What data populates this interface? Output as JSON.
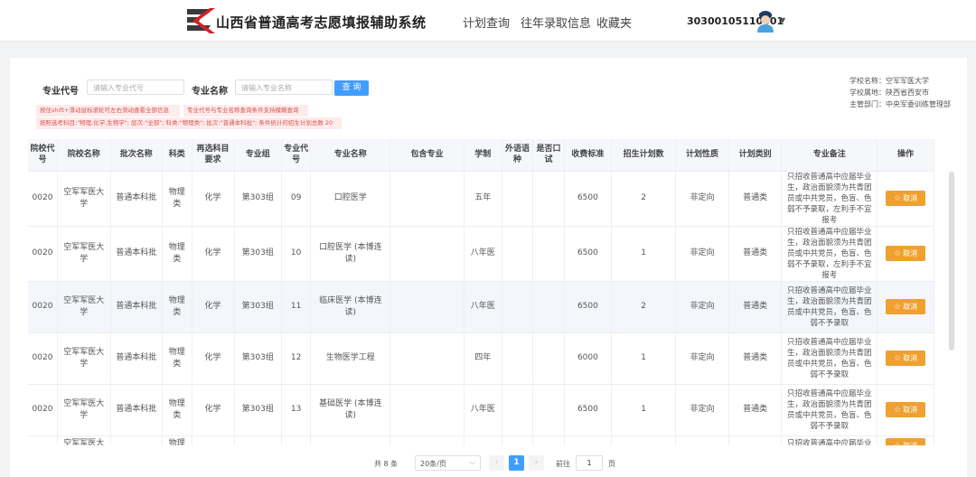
{
  "header": {
    "title": "山西省普通高考志愿填报辅助系统",
    "nav": [
      "计划查询",
      "往年录取信息",
      "收藏夹"
    ],
    "user_id": "30300105110001"
  },
  "search": {
    "major_code_label": "专业代号",
    "major_code_placeholder": "请输入专业代号",
    "major_name_label": "专业名称",
    "major_name_placeholder": "请输入专业名称",
    "button": "查 询"
  },
  "tips": {
    "tip1": "按住shift+滑动鼠标滚轮可左右滑动查看全部信息",
    "tip2": "专业代号与专业名称查询条件支持模糊查询",
    "tip3": "按照选考科目:\"物理,化学,生物学\"; 层次:\"全部\"; 科类:\"物理类\"; 批次:\"普通本科批\"; 条件统计的招生计划总数 20"
  },
  "school_info": [
    "学校名称：空军军医大学",
    "学校属地：陕西省西安市",
    "主管部门：中央军委训练管理部"
  ],
  "table": {
    "headers": [
      "院校代号",
      "院校名称",
      "批次名称",
      "科类",
      "再选科目要求",
      "专业组",
      "专业代号",
      "专业名称",
      "包含专业",
      "学制",
      "外语语种",
      "是否口试",
      "收费标准",
      "招生计划数",
      "计划性质",
      "计划类别",
      "专业备注",
      "操作"
    ],
    "action_label": "取消",
    "rows": [
      {
        "code": "0020",
        "school": "空军军医大学",
        "batch": "普通本科批",
        "category": "物理类",
        "req": "化学",
        "group": "第303组",
        "major_code": "09",
        "major": "口腔医学",
        "included": "",
        "years": "五年",
        "lang": "",
        "oral": "",
        "fee": "6500",
        "plan": "2",
        "nature": "非定向",
        "type": "普通类",
        "remark": "只招收普通高中应届毕业生，政治面貌须为共青团员或中共党员，色盲、色弱不予录取，左利手不宜报考"
      },
      {
        "code": "0020",
        "school": "空军军医大学",
        "batch": "普通本科批",
        "category": "物理类",
        "req": "化学",
        "group": "第303组",
        "major_code": "10",
        "major": "口腔医学 (本博连读)",
        "included": "",
        "years": "八年医",
        "lang": "",
        "oral": "",
        "fee": "6500",
        "plan": "1",
        "nature": "非定向",
        "type": "普通类",
        "remark": "只招收普通高中应届毕业生，政治面貌须为共青团员或中共党员，色盲、色弱不予录取，左利手不宜报考"
      },
      {
        "code": "0020",
        "school": "空军军医大学",
        "batch": "普通本科批",
        "category": "物理类",
        "req": "化学",
        "group": "第303组",
        "major_code": "11",
        "major": "临床医学 (本博连读)",
        "included": "",
        "years": "八年医",
        "lang": "",
        "oral": "",
        "fee": "6500",
        "plan": "2",
        "nature": "非定向",
        "type": "普通类",
        "remark": "只招收普通高中应届毕业生，政治面貌须为共青团员或中共党员，色盲、色弱不予录取"
      },
      {
        "code": "0020",
        "school": "空军军医大学",
        "batch": "普通本科批",
        "category": "物理类",
        "req": "化学",
        "group": "第303组",
        "major_code": "12",
        "major": "生物医学工程",
        "included": "",
        "years": "四年",
        "lang": "",
        "oral": "",
        "fee": "6000",
        "plan": "1",
        "nature": "非定向",
        "type": "普通类",
        "remark": "只招收普通高中应届毕业生，政治面貌须为共青团员或中共党员，色盲、色弱不予录取"
      },
      {
        "code": "0020",
        "school": "空军军医大学",
        "batch": "普通本科批",
        "category": "物理类",
        "req": "化学",
        "group": "第303组",
        "major_code": "13",
        "major": "基础医学 (本博连读)",
        "included": "",
        "years": "八年医",
        "lang": "",
        "oral": "",
        "fee": "6500",
        "plan": "1",
        "nature": "非定向",
        "type": "普通类",
        "remark": "只招收普通高中应届毕业生，政治面貌须为共青团员或中共党员，色盲、色弱不予录取"
      },
      {
        "code": "",
        "school": "空军军医大",
        "batch": "",
        "category": "物理",
        "req": "",
        "group": "",
        "major_code": "",
        "major": "",
        "included": "",
        "years": "",
        "lang": "",
        "oral": "",
        "fee": "",
        "plan": "",
        "nature": "",
        "type": "",
        "remark": "只招收普通高中应届毕业生，政治面貌须为共青团员"
      }
    ]
  },
  "pagination": {
    "total": "共 8 条",
    "page_size": "20条/页",
    "current": "1",
    "goto_label": "前往",
    "goto_value": "1",
    "page_suffix": "页"
  },
  "colors": {
    "primary": "#409eff",
    "action": "#f0a030",
    "tip_bg": "#fdecec",
    "tip_text": "#d9534f"
  }
}
